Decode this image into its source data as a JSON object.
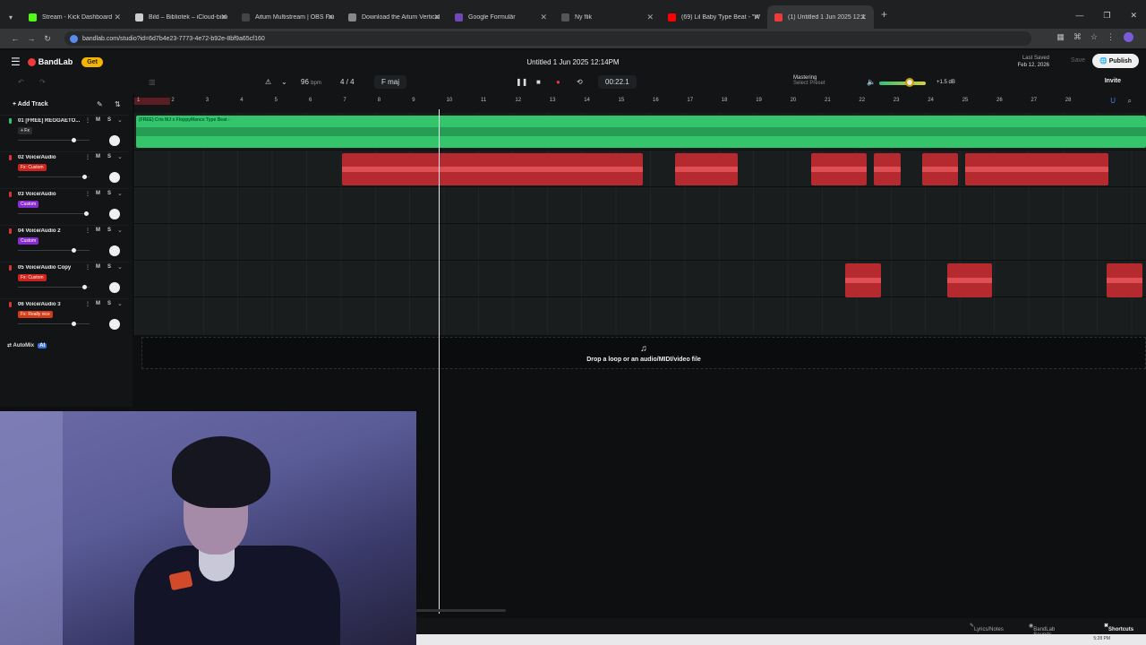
{
  "browser": {
    "tabs": [
      {
        "title": "Stream - Kick Dashboard",
        "color": "#53fc18"
      },
      {
        "title": "Bild – Bibliotek – iCloud-bilder",
        "color": "#cccccc"
      },
      {
        "title": "Aitum Multistream | OBS Forum",
        "color": "#444444"
      },
      {
        "title": "Download the Aitum Vertical Pl",
        "color": "#888888"
      },
      {
        "title": "Google Formulär",
        "color": "#7248b9"
      },
      {
        "title": "Ny flik",
        "color": "#555555"
      },
      {
        "title": "(69) Lil Baby Type Beat - \"Wen",
        "color": "#ff0000"
      },
      {
        "title": "(1) Untitled 1 Jun 2025 12:1",
        "color": "#ef3a3a"
      }
    ],
    "url": "bandlab.com/studio?id=6d7b4e23-7773-4e72-b92e-8bf9a65cf160"
  },
  "app": {
    "logo": "BandLab",
    "get_label": "Get",
    "title": "Untitled 1 Jun 2025 12:14PM",
    "last_saved_label": "Last Saved",
    "last_saved_date": "Feb 12, 2026",
    "save_label": "Save",
    "publish_label": "Publish",
    "invite_label": "Invite"
  },
  "transport": {
    "bpm": "96",
    "bpm_unit": "bpm",
    "time_signature": "4 / 4",
    "key": "F maj",
    "time": "00:22.1",
    "mastering_title": "Mastering",
    "mastering_preset": "Select Preset",
    "volume_db": "+1.5 dB",
    "volume_level": 0.66
  },
  "tracks_panel": {
    "add_track_label": "Add Track",
    "mute_label": "M",
    "solo_label": "S",
    "automix_label": "AutoMix",
    "automix_badge": "AI",
    "tracks": [
      {
        "name": "01  [FREE] REGGAETO...",
        "fx": "+ Fx",
        "fx_color": "#2a2d2f",
        "rec_color": "#2fc46b",
        "fader": 0.78
      },
      {
        "name": "02  Voice/Audio",
        "fx": "Fx: Custom",
        "fx_color": "#c22",
        "rec_color": "#d33",
        "fader": 0.93
      },
      {
        "name": "03  Voice/Audio",
        "fx": "Custom",
        "fx_color": "#8b2bd6",
        "rec_color": "#d33",
        "fader": 0.95
      },
      {
        "name": "04  Voice/Audio 2",
        "fx": "Custom",
        "fx_color": "#8b2bd6",
        "rec_color": "#d33",
        "fader": 0.78
      },
      {
        "name": "05  Voice/Audio Copy",
        "fx": "Fx: Custom",
        "fx_color": "#c22",
        "rec_color": "#d33",
        "fader": 0.93
      },
      {
        "name": "06  Voice/Audio 3",
        "fx": "Fx: Really nice",
        "fx_color": "#d23a1a",
        "rec_color": "#d33",
        "fader": 0.78
      }
    ]
  },
  "timeline": {
    "bars": [
      "1",
      "2",
      "3",
      "4",
      "5",
      "6",
      "7",
      "8",
      "9",
      "10",
      "11",
      "12",
      "13",
      "14",
      "15",
      "16",
      "17",
      "18",
      "19",
      "20",
      "21",
      "22",
      "23",
      "24",
      "25",
      "26",
      "27",
      "28"
    ],
    "beat_clip_label": "(FREE) Cris MJ x FloppyMance Type Beat -",
    "drop_text": "Drop a loop or an audio/MIDI/video file"
  },
  "bottom": {
    "lyrics": "Lyrics/Notes",
    "sounds": "BandLab Sounds",
    "shortcuts": "Shortcuts",
    "clock": "5:28 PM"
  }
}
